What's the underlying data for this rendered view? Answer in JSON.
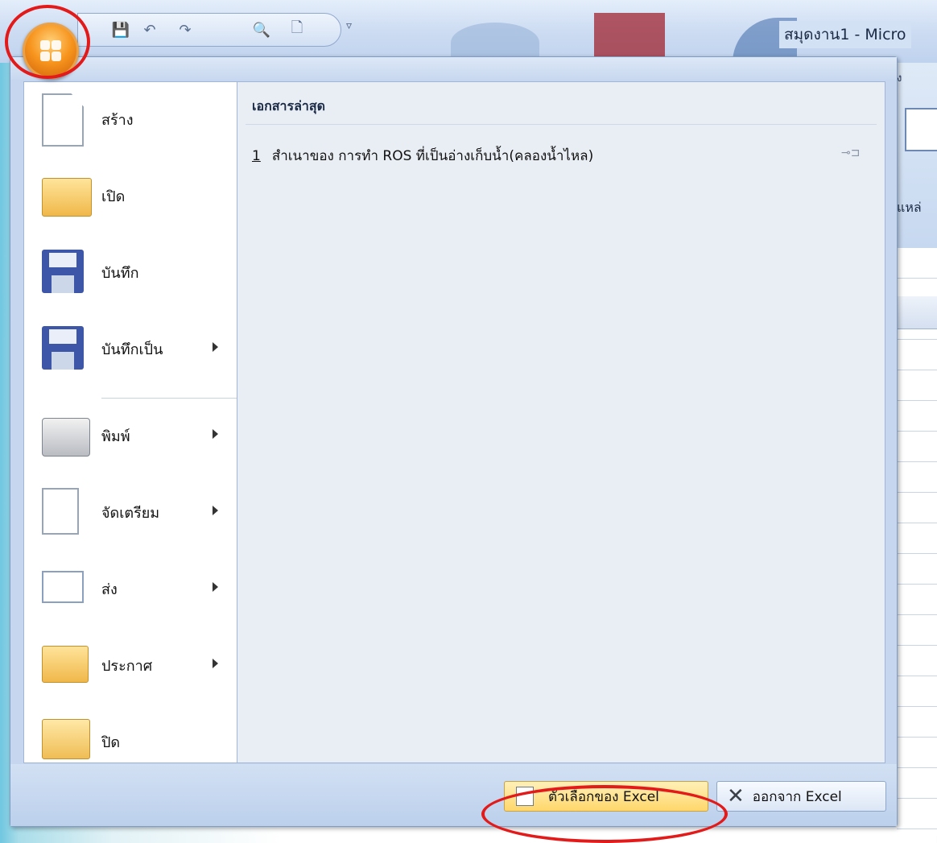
{
  "window": {
    "title": "สมุดงาน1 - Micro"
  },
  "quick_access": {
    "items": [
      {
        "name": "save",
        "glyph": "💾"
      },
      {
        "name": "undo",
        "glyph": "↶"
      },
      {
        "name": "redo",
        "glyph": "↷"
      },
      {
        "name": "print-preview",
        "glyph": "🔍"
      },
      {
        "name": "new",
        "glyph": "🗋"
      }
    ],
    "more_glyph": "▿"
  },
  "ribbon_fragment": {
    "tab": "ง",
    "label": "แหล่"
  },
  "office_menu": {
    "left_items": [
      {
        "label": "สร้าง",
        "icon": "new-document-icon",
        "submenu": false
      },
      {
        "label": "เปิด",
        "icon": "open-folder-icon",
        "submenu": false
      },
      {
        "label": "บันทึก",
        "icon": "save-icon",
        "submenu": false
      },
      {
        "label": "บันทึกเป็น",
        "icon": "save-as-icon",
        "submenu": true
      },
      {
        "label": "พิมพ์",
        "icon": "printer-icon",
        "submenu": true
      },
      {
        "label": "จัดเตรียม",
        "icon": "prepare-icon",
        "submenu": true
      },
      {
        "label": "ส่ง",
        "icon": "send-icon",
        "submenu": true
      },
      {
        "label": "ประกาศ",
        "icon": "publish-icon",
        "submenu": true
      },
      {
        "label": "ปิด",
        "icon": "close-icon",
        "submenu": false
      }
    ],
    "recent_header": "เอกสารล่าสุด",
    "recent_docs": [
      {
        "num": "1",
        "name": "สำเนาของ การทำ ROS ที่เป็นอ่างเก็บน้ำ(คลองน้ำไหล)"
      }
    ],
    "buttons": {
      "options": "ตัวเลือกของ Excel",
      "exit": "ออกจาก Excel"
    }
  }
}
